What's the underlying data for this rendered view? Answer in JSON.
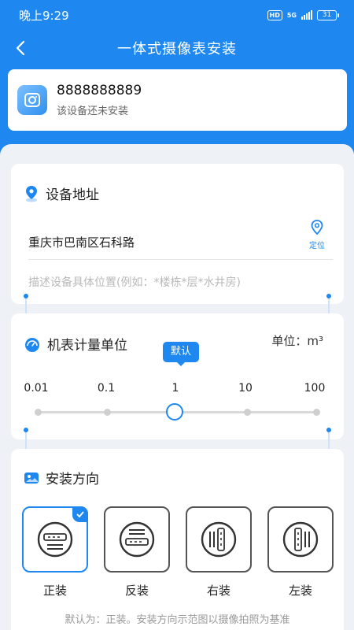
{
  "status_bar": {
    "time": "晚上9:29",
    "hd_badge": "HD",
    "network": "5G",
    "battery": "31"
  },
  "nav": {
    "title": "一体式摄像表安装"
  },
  "device": {
    "id": "8888888889",
    "status": "该设备还未安装"
  },
  "address_section": {
    "title": "设备地址",
    "address": "重庆市巴南区石科路",
    "locate_label": "定位",
    "detail_placeholder": "描述设备具体位置(例如：*楼栋*层*水井房)"
  },
  "unit_section": {
    "title": "机表计量单位",
    "unit_label": "单位：m³",
    "default_tooltip": "默认",
    "scale": [
      "0.01",
      "0.1",
      "1",
      "10",
      "100"
    ],
    "selected_index": 2
  },
  "direction_section": {
    "title": "安装方向",
    "options": [
      {
        "label": "正装",
        "icon": "meter-upright-icon",
        "selected": true
      },
      {
        "label": "反装",
        "icon": "meter-inverted-icon",
        "selected": false
      },
      {
        "label": "右装",
        "icon": "meter-right-icon",
        "selected": false
      },
      {
        "label": "左装",
        "icon": "meter-left-icon",
        "selected": false
      }
    ],
    "hint": "默认为：正装。安装方向示范图以摄像拍照为基准"
  },
  "colors": {
    "primary": "#1e88f0",
    "background": "#eef1f5",
    "card": "#ffffff"
  }
}
